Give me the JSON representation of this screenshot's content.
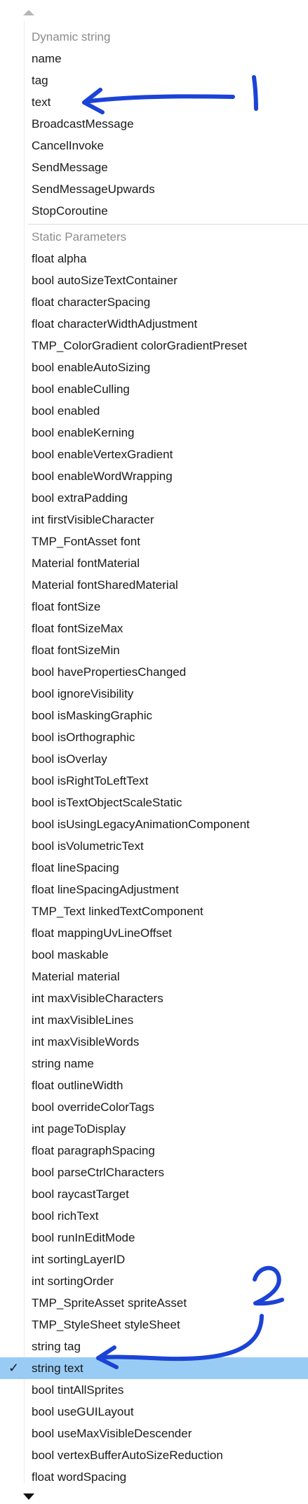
{
  "dynamic_header": "Dynamic string",
  "dynamic_items": [
    "name",
    "tag",
    "text",
    "BroadcastMessage",
    "CancelInvoke",
    "SendMessage",
    "SendMessageUpwards",
    "StopCoroutine"
  ],
  "static_header": "Static Parameters",
  "static_items": [
    "float alpha",
    "bool autoSizeTextContainer",
    "float characterSpacing",
    "float characterWidthAdjustment",
    "TMP_ColorGradient colorGradientPreset",
    "bool enableAutoSizing",
    "bool enableCulling",
    "bool enabled",
    "bool enableKerning",
    "bool enableVertexGradient",
    "bool enableWordWrapping",
    "bool extraPadding",
    "int firstVisibleCharacter",
    "TMP_FontAsset font",
    "Material fontMaterial",
    "Material fontSharedMaterial",
    "float fontSize",
    "float fontSizeMax",
    "float fontSizeMin",
    "bool havePropertiesChanged",
    "bool ignoreVisibility",
    "bool isMaskingGraphic",
    "bool isOrthographic",
    "bool isOverlay",
    "bool isRightToLeftText",
    "bool isTextObjectScaleStatic",
    "bool isUsingLegacyAnimationComponent",
    "bool isVolumetricText",
    "float lineSpacing",
    "float lineSpacingAdjustment",
    "TMP_Text linkedTextComponent",
    "float mappingUvLineOffset",
    "bool maskable",
    "Material material",
    "int maxVisibleCharacters",
    "int maxVisibleLines",
    "int maxVisibleWords",
    "string name",
    "float outlineWidth",
    "bool overrideColorTags",
    "int pageToDisplay",
    "float paragraphSpacing",
    "bool parseCtrlCharacters",
    "bool raycastTarget",
    "bool richText",
    "bool runInEditMode",
    "int sortingLayerID",
    "int sortingOrder",
    "TMP_SpriteAsset spriteAsset",
    "TMP_StyleSheet styleSheet",
    "string tag",
    "string text",
    "bool tintAllSprites",
    "bool useGUILayout",
    "bool useMaxVisibleDescender",
    "bool vertexBufferAutoSizeReduction",
    "float wordSpacing"
  ],
  "selected_item": "string text",
  "check_glyph": "✓",
  "annotations": {
    "label_1": "1",
    "label_2": "2",
    "ink_color": "#1b43d6"
  },
  "colors": {
    "selection": "#99ccf5",
    "header_text": "#8c8c8c"
  }
}
